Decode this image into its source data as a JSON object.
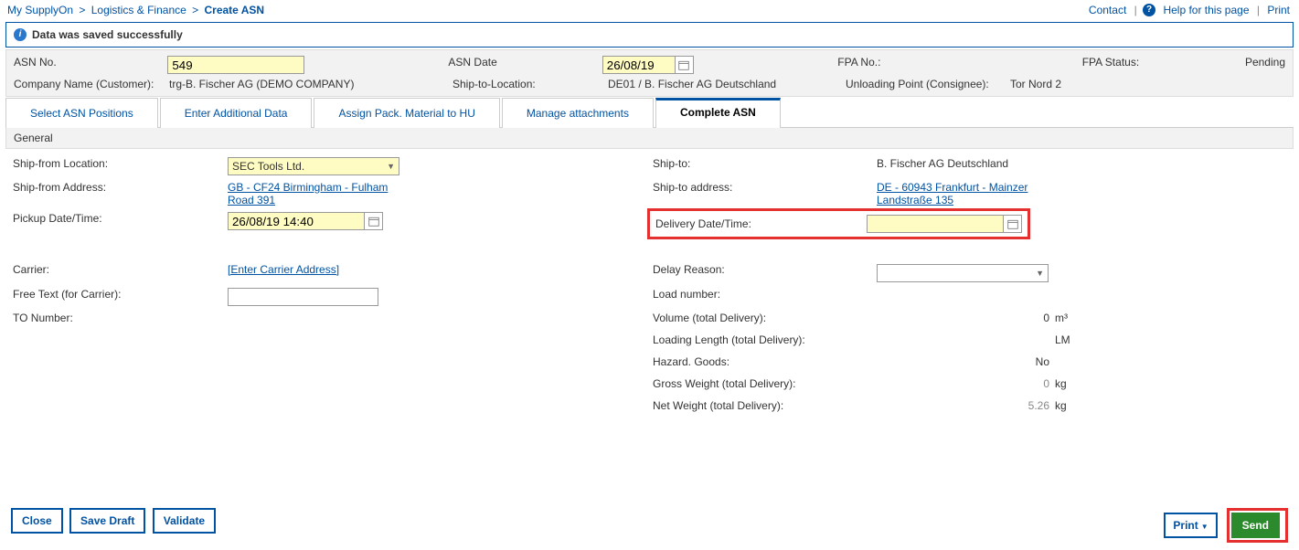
{
  "breadcrumb": {
    "a": "My SupplyOn",
    "b": "Logistics & Finance",
    "c": "Create ASN"
  },
  "toplinks": {
    "contact": "Contact",
    "help": "Help for this page",
    "print": "Print"
  },
  "message": "Data was saved successfully",
  "header": {
    "asn_no_lbl": "ASN No.",
    "asn_no": "549",
    "asn_date_lbl": "ASN Date",
    "asn_date": "26/08/19",
    "fpa_no_lbl": "FPA No.:",
    "fpa_status_lbl": "FPA Status:",
    "fpa_status": "Pending",
    "company_lbl": "Company Name (Customer):",
    "company": "trg-B. Fischer AG (DEMO COMPANY)",
    "shipto_loc_lbl": "Ship-to-Location:",
    "shipto_loc": "DE01 / B. Fischer AG Deutschland",
    "unload_lbl": "Unloading Point (Consignee):",
    "unload": "Tor Nord 2"
  },
  "tabs": {
    "t1": "Select ASN Positions",
    "t2": "Enter Additional Data",
    "t3": "Assign Pack. Material to HU",
    "t4": "Manage attachments",
    "t5": "Complete ASN"
  },
  "section": "General",
  "form": {
    "shipfrom_loc_lbl": "Ship-from Location:",
    "shipfrom_loc": "SEC Tools Ltd.",
    "shipfrom_addr_lbl": "Ship-from Address:",
    "shipfrom_addr": "GB - CF24 Birmingham - Fulham Road 391",
    "pickup_lbl": "Pickup Date/Time:",
    "pickup": "26/08/19 14:40",
    "carrier_lbl": "Carrier:",
    "carrier_link": "[Enter Carrier Address]",
    "freetext_lbl": "Free Text (for Carrier):",
    "to_number_lbl": "TO Number:",
    "shipto_lbl": "Ship-to:",
    "shipto": "B. Fischer AG Deutschland",
    "shipto_addr_lbl": "Ship-to address:",
    "shipto_addr": "DE - 60943 Frankfurt - Mainzer Landstraße 135",
    "delivery_lbl": "Delivery Date/Time:",
    "delivery": "",
    "delay_lbl": "Delay Reason:",
    "load_number_lbl": "Load number:",
    "volume_lbl": "Volume (total Delivery):",
    "volume": "0",
    "volume_unit": "m³",
    "loadlen_lbl": "Loading Length (total Delivery):",
    "loadlen_unit": "LM",
    "hazard_lbl": "Hazard. Goods:",
    "hazard": "No",
    "gross_lbl": "Gross Weight (total Delivery):",
    "gross": "0",
    "gross_unit": "kg",
    "net_lbl": "Net Weight (total Delivery):",
    "net": "5.26",
    "net_unit": "kg"
  },
  "buttons": {
    "close": "Close",
    "save": "Save Draft",
    "validate": "Validate",
    "print": "Print",
    "send": "Send"
  }
}
